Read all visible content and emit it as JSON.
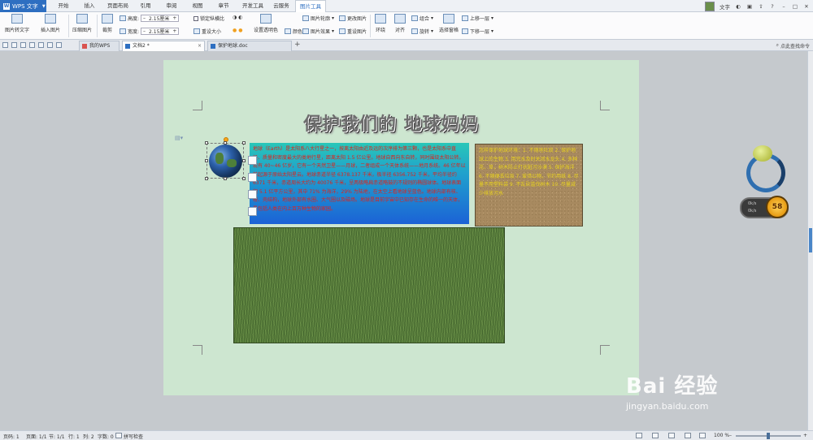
{
  "app": {
    "title": "WPS 文字"
  },
  "menu": {
    "tabs": [
      "开始",
      "插入",
      "页面布局",
      "引用",
      "审阅",
      "视图",
      "章节",
      "开发工具",
      "云服务",
      "图片工具"
    ],
    "active_tab": "图片工具",
    "user": "文字"
  },
  "ribbon": {
    "pic_to_text": "图片转文字",
    "insert_pic": "插入图片",
    "compress": "压缩图片",
    "crop": "裁剪",
    "rotate": "旋转",
    "height_label": "高度:",
    "height_value": "2.15厘米",
    "width_label": "宽度:",
    "width_value": "2.15厘米",
    "lock_ratio": "锁定纵横比",
    "reset_size": "重设大小",
    "set_transparent": "设置透明色",
    "color": "颜色",
    "pic_outline": "图片轮廓",
    "pic_effect": "图片效果",
    "change_pic": "更改图片",
    "reset_pic": "重设图片",
    "wrap": "环绕",
    "align": "对齐",
    "group": "组合",
    "rotate2": "旋转",
    "select_pane": "选择窗格",
    "bring_forward": "上移一层",
    "send_backward": "下移一层"
  },
  "tabbar": {
    "tabs": [
      {
        "label": "我的WPS"
      },
      {
        "label": "文档2 *"
      },
      {
        "label": "保护地球.doc"
      }
    ],
    "find": "点此查找命令"
  },
  "document": {
    "wordart": "保护我们的 地球妈妈",
    "body_text": "地球（Earth）是太阳系八大行星之一，按离太阳由近及远的次序排为第三颗，也是太阳系中直径、质量和密度最大的类地行星，距离太阳 1.5 亿公里。地球自西向东自转，同时围绕太阳公转。现有 40~46 亿岁，它有一个天然卫星——月球，二者组成一个天体系统——地月系统。46 亿年以前起源于原始太阳星云。地球赤道半径 6378.137 千米，极半径 6356.752 千米，平均半径约 6371 千米，赤道周长大约为 40076 千米，呈两极略扁赤道略鼓的不规则的椭圆球体。地球表面积 5.1 亿平方公里，其中 71% 为海洋，29% 为陆地，在太空上看地球呈蓝色。地球内部有核、幔、壳结构，地球外部有水圈、大气圈以及磁场。地球是目前宇宙中已知存在生命的唯一的天体，是包括人类在内上百万种生物的家园。",
    "side_text": "怎样保护地球环境：1. 不随地吐痰 2. 保护地球上的生物 3. 用完水及时关闭水龙头 4. 多种花、草，树木防止打扰脏污沙漠 5. 保护海洋 6. 不随便丢垃圾 7. 爱惜公物，节约用纸 8. 尽量不用塑料袋 9. 不乱砍滥伐树木 10. 尽量减少排放污水"
  },
  "widget": {
    "row1": "0k/s",
    "row2": "0k/s",
    "badge": "58"
  },
  "watermark": {
    "brand": "Bai 经验",
    "url": "jingyan.baidu.com"
  },
  "status": {
    "page": "页码: 1",
    "pages": "页面: 1/1",
    "section": "节: 1/1",
    "row": "行: 1",
    "col": "列: 2",
    "words": "字数: 0",
    "spell": "拼写检查",
    "zoom": "100 %",
    "zoom_level": 0.5
  },
  "colors": {
    "accent": "#2e6fc1",
    "page_bg": "#cde6d0",
    "text_red": "#e0221a",
    "text_yellow": "#e8d21e"
  }
}
